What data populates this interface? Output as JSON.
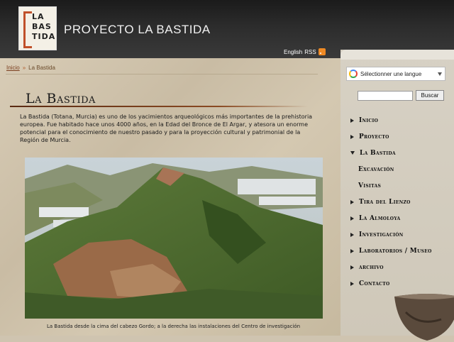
{
  "header": {
    "logo_lines": [
      "LA",
      "BAS",
      "TIDA"
    ],
    "site_title": "PROYECTO LA BASTIDA",
    "english_label": "English",
    "rss_label": "RSS",
    "rss_icon": "rss-icon"
  },
  "breadcrumb": {
    "home": "Inicio",
    "separator": "»",
    "current": "La Bastida"
  },
  "main": {
    "title": "La Bastida",
    "intro": "La Bastida (Totana, Murcia) es uno de los yacimientos arqueológicos más importantes de la prehistoria europea. Fue habitado hace unos 4000 años, en la Edad del Bronce de El Argar, y atesora un enorme potencial para el conocimiento de nuestro pasado y para la proyección cultural y patrimonial de la Región de Murcia.",
    "caption": "La Bastida desde la cima del cabezo Gordo; a la derecha las instalaciones del Centro de investigación"
  },
  "sidebar": {
    "translate_label": "Sélectionner une langue",
    "search_button": "Buscar",
    "search_value": "",
    "nav": [
      {
        "label": "Inicio",
        "marker": "right",
        "sub": false
      },
      {
        "label": "Proyecto",
        "marker": "right",
        "sub": false
      },
      {
        "label": "La Bastida",
        "marker": "down",
        "sub": false
      },
      {
        "label": "Excavación",
        "marker": "none",
        "sub": true
      },
      {
        "label": "Visitas",
        "marker": "none",
        "sub": true
      },
      {
        "label": "Tira del Lienzo",
        "marker": "right",
        "sub": false
      },
      {
        "label": "La Almoloya",
        "marker": "right",
        "sub": false
      },
      {
        "label": "Investigación",
        "marker": "right",
        "sub": false
      },
      {
        "label": "Laboratorios / Museo",
        "marker": "right",
        "sub": false
      },
      {
        "label": "archivo",
        "marker": "right",
        "sub": false
      },
      {
        "label": "Contacto",
        "marker": "right",
        "sub": false
      }
    ]
  },
  "colors": {
    "accent": "#c0502a",
    "header_bg": "#2a2a2a",
    "link": "#7a3d1d"
  }
}
